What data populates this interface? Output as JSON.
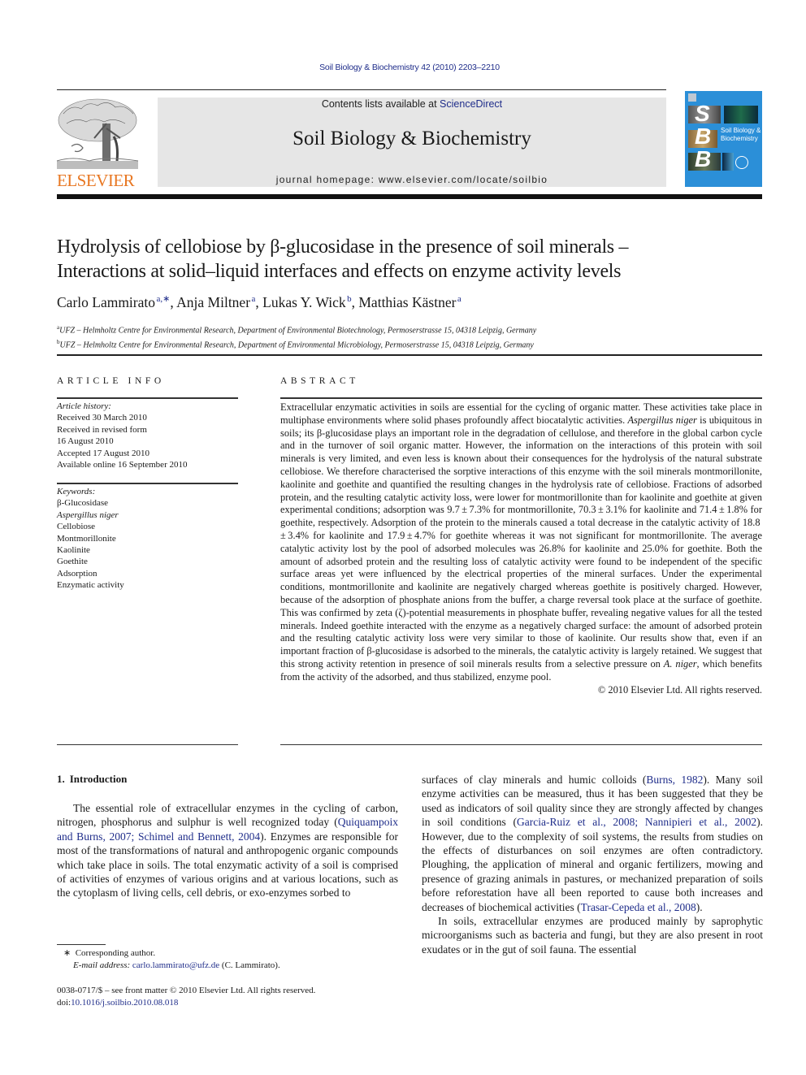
{
  "citation": "Soil Biology & Biochemistry 42 (2010) 2203–2210",
  "publisher": {
    "wordmark": "ELSEVIER",
    "brand_color": "#e87722"
  },
  "masthead": {
    "contents_prefix": "Contents lists available at ",
    "contents_link": "ScienceDirect",
    "journal_title": "Soil Biology & Biochemistry",
    "homepage": "journal homepage: www.elsevier.com/locate/soilbio"
  },
  "cover": {
    "letters": [
      "S",
      "B",
      "B"
    ],
    "title_line1": "Soil Biology &",
    "title_line2": "Biochemistry",
    "background_color": "#2b8fd8"
  },
  "article": {
    "title_line1": "Hydrolysis of cellobiose by β-glucosidase in the presence of soil minerals –",
    "title_line2": "Interactions at solid–liquid interfaces and effects on enzyme activity levels",
    "authors": [
      {
        "name": "Carlo Lammirato",
        "sup": "a,∗"
      },
      {
        "name": "Anja Miltner",
        "sup": "a"
      },
      {
        "name": "Lukas Y. Wick",
        "sup": "b"
      },
      {
        "name": "Matthias Kästner",
        "sup": "a"
      }
    ],
    "affiliations": [
      {
        "label": "a",
        "text": "UFZ – Helmholtz Centre for Environmental Research, Department of Environmental Biotechnology, Permoserstrasse 15, 04318 Leipzig, Germany"
      },
      {
        "label": "b",
        "text": "UFZ – Helmholtz Centre for Environmental Research, Department of Environmental Microbiology, Permoserstrasse 15, 04318 Leipzig, Germany"
      }
    ]
  },
  "article_info": {
    "heading": "ARTICLE INFO",
    "history_label": "Article history:",
    "history": [
      "Received 30 March 2010",
      "Received in revised form",
      "16 August 2010",
      "Accepted 17 August 2010",
      "Available online 16 September 2010"
    ],
    "keywords_label": "Keywords:",
    "keywords": [
      "β-Glucosidase",
      "Aspergillus niger",
      "Cellobiose",
      "Montmorillonite",
      "Kaolinite",
      "Goethite",
      "Adsorption",
      "Enzymatic activity"
    ]
  },
  "abstract": {
    "heading": "ABSTRACT",
    "part1": "Extracellular enzymatic activities in soils are essential for the cycling of organic matter. These activities take place in multiphase environments where solid phases profoundly affect biocatalytic activities. ",
    "organism": "Aspergillus niger",
    "part2": " is ubiquitous in soils; its β-glucosidase plays an important role in the degradation of cellulose, and therefore in the global carbon cycle and in the turnover of soil organic matter. However, the information on the interactions of this protein with soil minerals is very limited, and even less is known about their consequences for the hydrolysis of the natural substrate cellobiose. We therefore characterised the sorptive interactions of this enzyme with the soil minerals montmorillonite, kaolinite and goethite and quantified the resulting changes in the hydrolysis rate of cellobiose. Fractions of adsorbed protein, and the resulting catalytic activity loss, were lower for montmorillonite than for kaolinite and goethite at given experimental conditions; adsorption was 9.7 ± 7.3% for montmorillonite, 70.3 ± 3.1% for kaolinite and 71.4 ± 1.8% for goethite, respectively. Adsorption of the protein to the minerals caused a total decrease in the catalytic activity of 18.8 ± 3.4% for kaolinite and 17.9 ± 4.7% for goethite whereas it was not significant for montmorillonite. The average catalytic activity lost by the pool of adsorbed molecules was 26.8% for kaolinite and 25.0% for goethite. Both the amount of adsorbed protein and the resulting loss of catalytic activity were found to be independent of the specific surface areas yet were influenced by the electrical properties of the mineral surfaces. Under the experimental conditions, montmorillonite and kaolinite are negatively charged whereas goethite is positively charged. However, because of the adsorption of phosphate anions from the buffer, a charge reversal took place at the surface of goethite. This was confirmed by zeta (ζ)-potential measurements in phosphate buffer, revealing negative values for all the tested minerals. Indeed goethite interacted with the enzyme as a negatively charged surface: the amount of adsorbed protein and the resulting catalytic activity loss were very similar to those of kaolinite. Our results show that, even if an important fraction of β-glucosidase is adsorbed to the minerals, the catalytic activity is largely retained. We suggest that this strong activity retention in presence of soil minerals results from a selective pressure on ",
    "organism_short": "A. niger",
    "part3": ", which benefits from the activity of the adsorbed, and thus stabilized, enzyme pool.",
    "copyright": "© 2010 Elsevier Ltd. All rights reserved."
  },
  "introduction": {
    "number": "1.",
    "heading": "Introduction",
    "left": {
      "p1_a": "The essential role of extracellular enzymes in the cycling of carbon, nitrogen, phosphorus and sulphur is well recognized today (",
      "p1_ref": "Quiquampoix and Burns, 2007; Schimel and Bennett, 2004",
      "p1_b": "). Enzymes are responsible for most of the transformations of natural and anthropogenic organic compounds which take place in soils. The total enzymatic activity of a soil is comprised of activities of enzymes of various origins and at various locations, such as the cytoplasm of living cells, cell debris, or exo-enzymes sorbed to"
    },
    "right": {
      "p1_a": "surfaces of clay minerals and humic colloids (",
      "ref1": "Burns, 1982",
      "p1_b": "). Many soil enzyme activities can be measured, thus it has been suggested that they be used as indicators of soil quality since they are strongly affected by changes in soil conditions (",
      "ref2": "Garcia-Ruiz et al., 2008; Nannipieri et al., 2002",
      "p1_c": "). However, due to the complexity of soil systems, the results from studies on the effects of disturbances on soil enzymes are often contradictory. Ploughing, the application of mineral and organic fertilizers, mowing and presence of grazing animals in pastures, or mechanized preparation of soils before reforestation have all been reported to cause both increases and decreases of biochemical activities (",
      "ref3": "Trasar-Cepeda et al., 2008",
      "p1_d": ").",
      "p2": "In soils, extracellular enzymes are produced mainly by saprophytic microorganisms such as bacteria and fungi, but they are also present in root exudates or in the gut of soil fauna. The essential"
    }
  },
  "footnote": {
    "marker": "∗",
    "corresponding": "Corresponding author.",
    "email_label": "E-mail address:",
    "email": "carlo.lammirato@ufz.de",
    "email_suffix": " (C. Lammirato)."
  },
  "front_matter": {
    "issn_line": "0038-0717/$ – see front matter © 2010 Elsevier Ltd. All rights reserved.",
    "doi_label": "doi:",
    "doi": "10.1016/j.soilbio.2010.08.018"
  },
  "link_color": "#1f2d8a"
}
